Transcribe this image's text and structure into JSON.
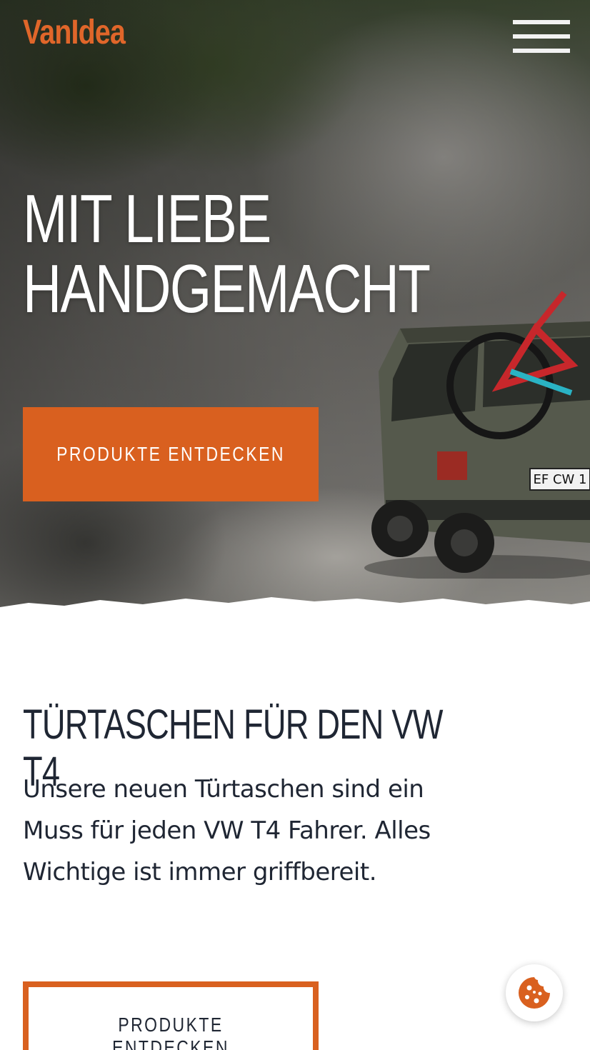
{
  "header": {
    "logo": "VanIdea",
    "menu_icon": "hamburger-menu-icon"
  },
  "hero": {
    "title_line1": "MIT LIEBE",
    "title_line2": "HANDGEMACHT",
    "cta_label": "PRODUKTE ENTDECKEN",
    "license_plate": "EF CW 1"
  },
  "section": {
    "title": "TÜRTASCHEN FÜR DEN VW T4",
    "text": "Unsere neuen Türtaschen sind ein Muss für jeden VW T4 Fahrer. Alles Wichtige ist immer griffbereit.",
    "cta_label": "PRODUKTE ENTDECKEN"
  },
  "cookie": {
    "icon": "cookie-icon"
  },
  "colors": {
    "accent": "#d9601f",
    "logo": "#e0662a",
    "text_dark": "#1f2633",
    "white": "#ffffff"
  }
}
